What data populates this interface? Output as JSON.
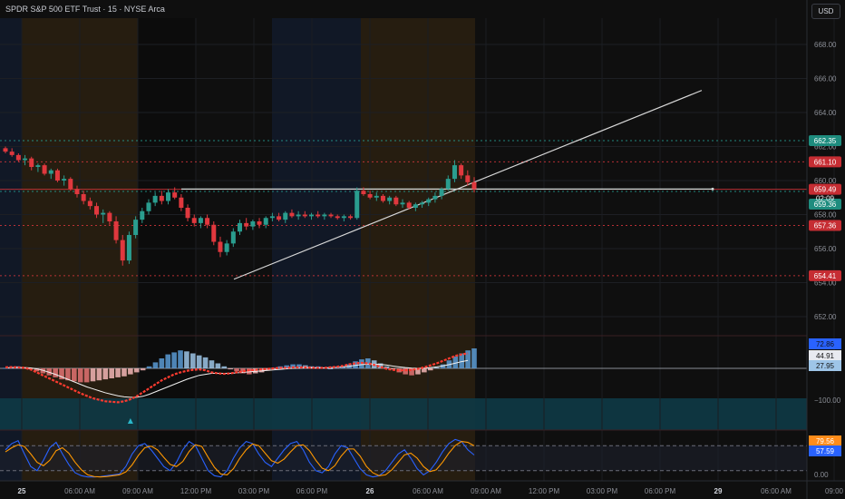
{
  "header": {
    "title": "SPDR S&P 500 ETF Trust · 15 · NYSE Arca",
    "currency": "USD"
  },
  "colors": {
    "background": "#0f0f0f",
    "bull": "#2a9d8f",
    "bear": "#e0383e",
    "session_pre": "#2a2010",
    "session_post": "#121a2a",
    "trendline": "#d8d8d8",
    "macd_line": "#2962ff",
    "signal_line": "#f0f0f0",
    "stoch_k": "#2962ff",
    "stoch_d": "#ff9800",
    "oversold_zone": "#0e3a46"
  },
  "chart_data": [
    {
      "type": "candlestick",
      "title": "SPDR S&P 500 ETF Trust · 15 · NYSE Arca",
      "ylim": [
        651.0,
        669.0
      ],
      "y_ticks": [
        652.0,
        654.0,
        656.0,
        658.0,
        660.0,
        662.0,
        664.0,
        666.0,
        668.0
      ],
      "x_tick_labels": [
        "25",
        "06:00 AM",
        "09:00 AM",
        "12:00 PM",
        "03:00 PM",
        "06:00 PM",
        "26",
        "06:00 AM",
        "09:00 AM",
        "12:00 PM",
        "03:00 PM",
        "06:00 PM",
        "29",
        "06:00 AM",
        "09:00"
      ],
      "x_tick_bold": [
        "25",
        "26",
        "29"
      ],
      "price_lines": [
        {
          "value": 662.35,
          "label": "662.35",
          "color": "#26a69a",
          "style": "dotted"
        },
        {
          "value": 661.1,
          "label": "661.10",
          "color": "#e0383e",
          "style": "dotted"
        },
        {
          "value": 659.49,
          "label": "659.49",
          "color": "#e0383e",
          "style": "solid"
        },
        {
          "value": 659.36,
          "label": "659.36",
          "color": "#26a69a",
          "style": "dotted"
        },
        {
          "value": 657.36,
          "label": "657.36",
          "color": "#e0383e",
          "style": "dotted"
        },
        {
          "value": 654.41,
          "label": "654.41",
          "color": "#e0383e",
          "style": "dotted"
        }
      ],
      "countdown": "02:09",
      "horizontal_ray": {
        "value": 659.5
      },
      "trendline": {
        "from": {
          "time": "Sep 25 02:30 PM",
          "price": 654.2
        },
        "to": {
          "time": "Sep 29 12:45 AM",
          "price": 665.3
        }
      },
      "candles_ohlc": [
        [
          661.9,
          662.0,
          661.6,
          661.7
        ],
        [
          661.7,
          661.9,
          661.4,
          661.5
        ],
        [
          661.5,
          661.6,
          661.1,
          661.2
        ],
        [
          661.2,
          661.5,
          660.9,
          661.3
        ],
        [
          661.3,
          661.4,
          660.6,
          660.8
        ],
        [
          660.8,
          661.0,
          660.5,
          660.9
        ],
        [
          660.9,
          661.0,
          660.3,
          660.4
        ],
        [
          660.4,
          660.7,
          660.1,
          660.6
        ],
        [
          660.6,
          660.7,
          659.9,
          660.0
        ],
        [
          660.0,
          660.3,
          659.7,
          660.1
        ],
        [
          660.1,
          660.2,
          659.4,
          659.5
        ],
        [
          659.5,
          659.7,
          659.0,
          659.2
        ],
        [
          659.2,
          659.4,
          658.6,
          658.8
        ],
        [
          658.8,
          659.0,
          658.3,
          658.5
        ],
        [
          658.5,
          658.7,
          657.8,
          658.0
        ],
        [
          658.0,
          658.3,
          657.5,
          658.1
        ],
        [
          658.1,
          658.2,
          657.4,
          657.6
        ],
        [
          657.6,
          657.9,
          656.3,
          656.5
        ],
        [
          656.5,
          656.8,
          655.0,
          655.3
        ],
        [
          655.3,
          657.0,
          655.1,
          656.8
        ],
        [
          656.8,
          657.9,
          656.6,
          657.7
        ],
        [
          657.7,
          658.4,
          657.5,
          658.2
        ],
        [
          658.2,
          658.9,
          658.0,
          658.7
        ],
        [
          658.7,
          659.3,
          658.5,
          659.1
        ],
        [
          659.1,
          659.4,
          658.6,
          658.8
        ],
        [
          658.8,
          659.5,
          658.6,
          659.3
        ],
        [
          659.3,
          659.6,
          658.9,
          659.0
        ],
        [
          659.0,
          659.2,
          658.2,
          658.4
        ],
        [
          658.4,
          658.6,
          657.6,
          657.8
        ],
        [
          657.8,
          658.0,
          657.3,
          657.5
        ],
        [
          657.5,
          657.9,
          657.2,
          657.8
        ],
        [
          657.8,
          658.0,
          657.2,
          657.4
        ],
        [
          657.4,
          657.6,
          656.2,
          656.4
        ],
        [
          656.4,
          656.7,
          655.5,
          655.8
        ],
        [
          655.8,
          656.5,
          655.6,
          656.3
        ],
        [
          656.3,
          657.2,
          656.1,
          657.0
        ],
        [
          657.0,
          657.7,
          656.8,
          657.5
        ],
        [
          657.5,
          657.8,
          657.1,
          657.3
        ],
        [
          657.3,
          657.7,
          657.1,
          657.6
        ],
        [
          657.6,
          657.8,
          657.2,
          657.4
        ],
        [
          657.4,
          657.9,
          657.2,
          657.8
        ],
        [
          657.8,
          658.1,
          657.6,
          657.9
        ],
        [
          657.9,
          658.1,
          657.6,
          657.7
        ],
        [
          657.7,
          658.2,
          657.5,
          658.1
        ],
        [
          658.1,
          658.3,
          657.8,
          657.9
        ],
        [
          657.9,
          658.2,
          657.7,
          658.0
        ],
        [
          658.0,
          658.2,
          657.8,
          657.9
        ],
        [
          657.9,
          658.1,
          657.7,
          658.0
        ],
        [
          658.0,
          658.2,
          657.8,
          657.9
        ],
        [
          657.9,
          658.1,
          657.7,
          658.0
        ],
        [
          658.0,
          658.1,
          657.8,
          657.9
        ],
        [
          657.9,
          658.0,
          657.7,
          657.8
        ],
        [
          657.8,
          658.0,
          657.6,
          657.9
        ],
        [
          657.9,
          658.0,
          657.7,
          657.8
        ],
        [
          657.8,
          659.6,
          657.7,
          659.4
        ],
        [
          659.4,
          659.6,
          659.1,
          659.2
        ],
        [
          659.2,
          659.4,
          658.9,
          659.0
        ],
        [
          659.0,
          659.3,
          658.8,
          659.1
        ],
        [
          659.1,
          659.2,
          658.7,
          658.8
        ],
        [
          658.8,
          659.1,
          658.6,
          659.0
        ],
        [
          659.0,
          659.1,
          658.5,
          658.6
        ],
        [
          658.6,
          658.9,
          658.4,
          658.7
        ],
        [
          658.7,
          658.8,
          658.3,
          658.4
        ],
        [
          658.4,
          658.7,
          658.2,
          658.6
        ],
        [
          658.6,
          658.8,
          658.4,
          658.7
        ],
        [
          658.7,
          659.0,
          658.5,
          658.9
        ],
        [
          658.9,
          659.3,
          658.7,
          659.1
        ],
        [
          659.1,
          659.6,
          658.9,
          659.5
        ],
        [
          659.5,
          660.3,
          659.4,
          660.1
        ],
        [
          660.1,
          661.2,
          659.9,
          660.9
        ],
        [
          660.9,
          661.0,
          660.1,
          660.3
        ],
        [
          660.3,
          660.6,
          659.7,
          659.9
        ],
        [
          659.9,
          660.2,
          659.3,
          659.49
        ]
      ]
    },
    {
      "type": "histogram",
      "name": "MACD",
      "value_labels": [
        "72.86",
        "44.91",
        "27.95"
      ],
      "zero_line": 0,
      "histogram": [
        0.5,
        1,
        2,
        1,
        -1,
        -3,
        -5,
        -7,
        -9,
        -11,
        -12,
        -13,
        -14,
        -14,
        -13,
        -12,
        -11,
        -10,
        -9,
        -8,
        -6,
        -4,
        -2,
        2,
        6,
        10,
        14,
        16,
        18,
        17,
        15,
        13,
        11,
        8,
        5,
        2,
        -1,
        -3,
        -5,
        -6,
        -5,
        -4,
        -2,
        0,
        2,
        3,
        4,
        4,
        3,
        2,
        2,
        1,
        0,
        1,
        2,
        4,
        7,
        9,
        10,
        8,
        5,
        2,
        -1,
        -4,
        -6,
        -7,
        -6,
        -4,
        -2,
        1,
        4,
        8,
        12,
        15,
        18,
        20
      ],
      "macd": [
        2,
        2.5,
        2,
        1,
        -2,
        -8,
        -14,
        -20,
        -26,
        -32,
        -38,
        -44,
        -50,
        -55,
        -60,
        -63,
        -66,
        -67,
        -68,
        -66,
        -62,
        -56,
        -48,
        -40,
        -32,
        -24,
        -18,
        -12,
        -8,
        -5,
        -3,
        -2,
        -4,
        -8,
        -10,
        -11,
        -10,
        -8,
        -6,
        -4,
        -3,
        -2,
        -1,
        0,
        1,
        1,
        2,
        2,
        2,
        1,
        1,
        1,
        2,
        3,
        5,
        8,
        10,
        11,
        10,
        7,
        3,
        -1,
        -3,
        -4,
        -4,
        -3,
        -1,
        2,
        6,
        10,
        15,
        20,
        25,
        28,
        30
      ],
      "signal": [
        1,
        1.5,
        1.8,
        1.6,
        1,
        -1,
        -4,
        -8,
        -12,
        -17,
        -22,
        -27,
        -32,
        -37,
        -41,
        -45,
        -49,
        -52,
        -55,
        -57,
        -58,
        -58,
        -56,
        -52,
        -47,
        -42,
        -37,
        -32,
        -27,
        -22,
        -18,
        -14,
        -12,
        -10,
        -10,
        -10,
        -10,
        -9,
        -8,
        -7,
        -6,
        -5,
        -4,
        -3,
        -2,
        -1,
        0,
        0.5,
        1,
        1,
        1,
        1,
        1.5,
        2,
        3,
        4,
        6,
        7.5,
        8.5,
        8.5,
        8,
        6.5,
        4.5,
        3,
        1.5,
        0.5,
        0,
        0.5,
        1.5,
        3,
        5,
        7.5,
        10.5,
        13.5,
        16
      ],
      "signal_arrow_at_index": 20
    },
    {
      "type": "line",
      "name": "Stochastic RSI",
      "ylim": [
        0,
        100
      ],
      "y_ticks": [
        0.0
      ],
      "value_labels": [
        "79.56",
        "57.59"
      ],
      "levels": [
        80,
        20
      ],
      "series": [
        {
          "name": "K",
          "values": [
            70,
            85,
            92,
            60,
            30,
            20,
            45,
            75,
            88,
            60,
            35,
            15,
            8,
            5,
            5,
            6,
            8,
            10,
            12,
            30,
            60,
            80,
            85,
            70,
            50,
            30,
            20,
            40,
            70,
            90,
            80,
            50,
            20,
            8,
            5,
            20,
            50,
            75,
            90,
            85,
            60,
            40,
            30,
            50,
            70,
            85,
            90,
            70,
            40,
            20,
            15,
            30,
            60,
            80,
            75,
            50,
            25,
            10,
            5,
            8,
            20,
            40,
            60,
            70,
            50,
            25,
            10,
            20,
            40,
            65,
            85,
            95,
            90,
            70,
            57.59
          ]
        },
        {
          "name": "D",
          "values": [
            65,
            75,
            82,
            78,
            60,
            40,
            32,
            45,
            68,
            75,
            62,
            40,
            22,
            10,
            6,
            5,
            6,
            8,
            10,
            17,
            34,
            57,
            75,
            79,
            70,
            52,
            35,
            30,
            42,
            66,
            82,
            78,
            52,
            28,
            12,
            10,
            25,
            50,
            70,
            84,
            80,
            62,
            44,
            38,
            48,
            65,
            80,
            82,
            68,
            45,
            26,
            20,
            32,
            55,
            72,
            72,
            55,
            30,
            15,
            8,
            10,
            22,
            40,
            58,
            62,
            50,
            30,
            18,
            22,
            40,
            62,
            80,
            90,
            88,
            79.56
          ]
        }
      ]
    }
  ]
}
